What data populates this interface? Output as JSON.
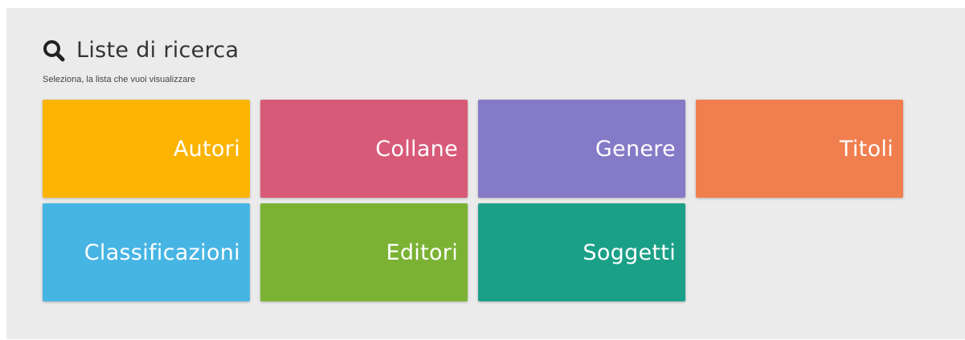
{
  "header": {
    "title": "Liste di ricerca",
    "subtitle": "Seleziona, la lista che vuoi visualizzare",
    "icon": "search-icon"
  },
  "tiles": [
    {
      "label": "Autori",
      "color": "#fbb402"
    },
    {
      "label": "Collane",
      "color": "#d85a79"
    },
    {
      "label": "Genere",
      "color": "#847ac7"
    },
    {
      "label": "Titoli",
      "color": "#f07e4e"
    },
    {
      "label": "Classificazioni",
      "color": "#47b5e3"
    },
    {
      "label": "Editori",
      "color": "#7bb234"
    },
    {
      "label": "Soggetti",
      "color": "#1ba088"
    }
  ]
}
